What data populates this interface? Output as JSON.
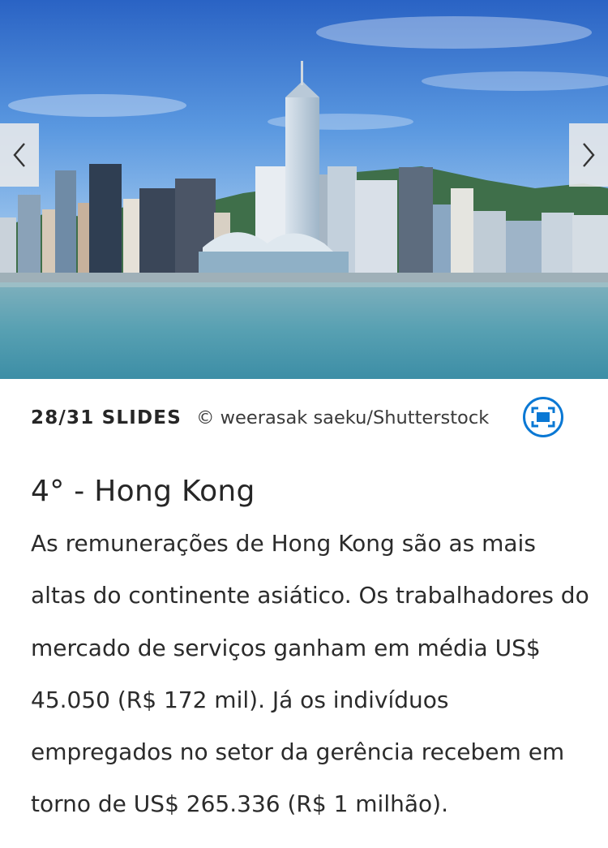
{
  "slideshow": {
    "counter": "28/31 SLIDES",
    "credit": "© weerasak saeku/Shutterstock",
    "title": "4° - Hong Kong",
    "body": "As remunerações de Hong Kong são as mais altas do continente asiático. Os trabalhadores do mercado de serviços ganham em média US$ 45.050 (R$ 172 mil). Já os indivíduos empregados no setor da gerência recebem em torno de US$ 265.336 (R$ 1 milhão).",
    "icons": {
      "prev": "chevron-left-icon",
      "next": "chevron-right-icon",
      "fullscreen": "fullscreen-icon"
    },
    "colors": {
      "accent": "#0a78d4",
      "text": "#262626",
      "arrow_bg": "#ebebeb"
    }
  }
}
